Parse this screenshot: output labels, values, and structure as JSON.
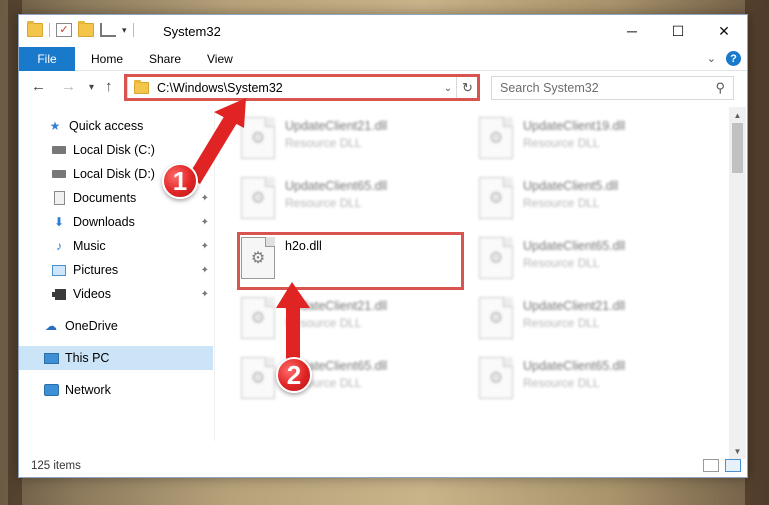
{
  "window": {
    "title": "System32"
  },
  "ribbon": {
    "tabs": [
      "File",
      "Home",
      "Share",
      "View"
    ]
  },
  "address": {
    "path": "C:\\Windows\\System32"
  },
  "search": {
    "placeholder": "Search System32"
  },
  "sidebar": {
    "items": [
      {
        "label": "Quick access",
        "icon": "star-icon"
      },
      {
        "label": "Local Disk (C:)",
        "icon": "disk-icon"
      },
      {
        "label": "Local Disk (D:)",
        "icon": "disk-icon"
      },
      {
        "label": "Documents",
        "icon": "documents-icon"
      },
      {
        "label": "Downloads",
        "icon": "download-icon"
      },
      {
        "label": "Music",
        "icon": "music-icon"
      },
      {
        "label": "Pictures",
        "icon": "pictures-icon"
      },
      {
        "label": "Videos",
        "icon": "videos-icon"
      },
      {
        "label": "OneDrive",
        "icon": "cloud-icon"
      },
      {
        "label": "This PC",
        "icon": "computer-icon",
        "selected": true
      },
      {
        "label": "Network",
        "icon": "network-icon"
      }
    ]
  },
  "files": {
    "left": [
      {
        "name": "UpdateClient21.dll",
        "type": "Resource DLL"
      },
      {
        "name": "UpdateClient65.dll",
        "type": "Resource DLL"
      },
      {
        "name": "h2o.dll",
        "type": ""
      },
      {
        "name": "UpdateClient21.dll",
        "type": "Resource DLL"
      },
      {
        "name": "UpdateClient65.dll",
        "type": "Resource DLL"
      }
    ],
    "right": [
      {
        "name": "UpdateClient19.dll",
        "type": "Resource DLL"
      },
      {
        "name": "UpdateClient5.dll",
        "type": "Resource DLL"
      },
      {
        "name": "UpdateClient65.dll",
        "type": "Resource DLL"
      },
      {
        "name": "UpdateClient21.dll",
        "type": "Resource DLL"
      },
      {
        "name": "UpdateClient65.dll",
        "type": "Resource DLL"
      }
    ]
  },
  "status": {
    "count": "125 items"
  },
  "annotations": {
    "step1": "1",
    "step2": "2",
    "color": "#e02424"
  }
}
